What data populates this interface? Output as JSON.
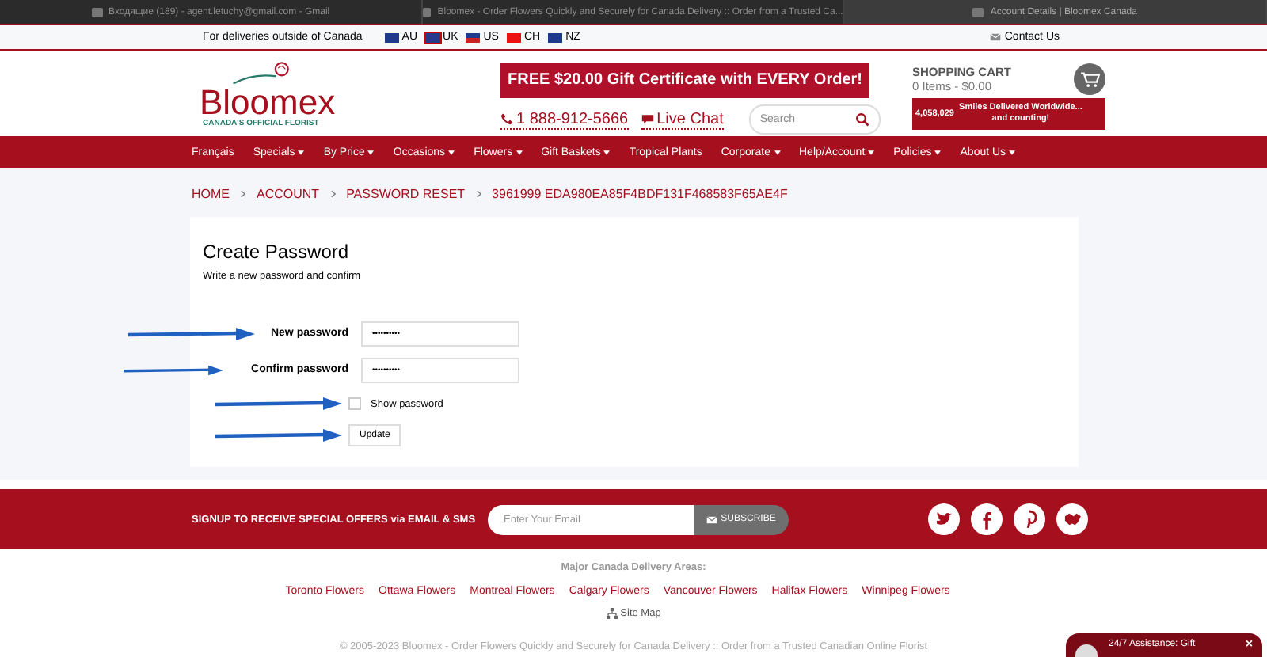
{
  "browser_tabs": [
    {
      "title": "Входящие (189) - agent.letuchy@gmail.com - Gmail",
      "selected": false
    },
    {
      "title": "Bloomex - Order Flowers Quickly and Securely for Canada Delivery :: Order from a Trusted Ca...",
      "selected": false
    },
    {
      "title": "Account Details | Bloomex Canada",
      "selected": true
    }
  ],
  "top_strip": {
    "text": "For deliveries outside of Canada",
    "countries": [
      "AU",
      "UK",
      "US",
      "CH",
      "NZ"
    ],
    "contact": "Contact Us"
  },
  "header": {
    "logo": "Bloomex",
    "tagline": "CANADA'S OFFICIAL FLORIST",
    "promo": "FREE $20.00 Gift Certificate with EVERY Order!",
    "phone": "1 888-912-5666",
    "chat": "Live Chat",
    "search": {
      "placeholder": "Search"
    },
    "cart_title": "SHOPPING CART",
    "cart_summary": "0 Items - $0.00",
    "smiles_count": "4,058,029",
    "smiles_text": "Smiles Delivered Worldwide... and counting!"
  },
  "nav": [
    {
      "label": "Français",
      "dropdown": false
    },
    {
      "label": "Specials",
      "dropdown": true
    },
    {
      "label": "By Price",
      "dropdown": true
    },
    {
      "label": "Occasions",
      "dropdown": true
    },
    {
      "label": "Flowers",
      "dropdown": true
    },
    {
      "label": "Gift Baskets",
      "dropdown": true
    },
    {
      "label": "Tropical Plants",
      "dropdown": false
    },
    {
      "label": "Corporate",
      "dropdown": true
    },
    {
      "label": "Help/Account",
      "dropdown": true
    },
    {
      "label": "Policies",
      "dropdown": true
    },
    {
      "label": "About Us",
      "dropdown": true
    }
  ],
  "breadcrumb": [
    "HOME",
    "ACCOUNT",
    "PASSWORD RESET",
    "3961999 EDA980EA85F4BDF131F468583F65AE4F"
  ],
  "form": {
    "title": "Create Password",
    "subtitle": "Write a new password and confirm",
    "fields": [
      {
        "label": "New password",
        "value": "••••••••••"
      },
      {
        "label": "Confirm password",
        "value": "••••••••••"
      }
    ],
    "show_password": {
      "label": "Show password",
      "checked": false
    },
    "button": "Update"
  },
  "footer": {
    "signup": "SIGNUP TO RECEIVE SPECIAL OFFERS via EMAIL & SMS",
    "email": {
      "placeholder": "Enter Your Email"
    },
    "subscribe": "SUBSCRIBE",
    "areas_title": "Major Canada Delivery Areas:",
    "areas": [
      "Toronto Flowers",
      "Ottawa Flowers",
      "Montreal Flowers",
      "Calgary Flowers",
      "Vancouver Flowers",
      "Halifax Flowers",
      "Winnipeg Flowers"
    ],
    "site_map": "Site Map",
    "copyright": "© 2005-2023 Bloomex - Order Flowers Quickly and Securely for Canada Delivery :: Order from a Trusted Canadian Online Florist"
  },
  "chat_widget": {
    "text": "24/7 Assistance: Gift",
    "close": "×"
  }
}
